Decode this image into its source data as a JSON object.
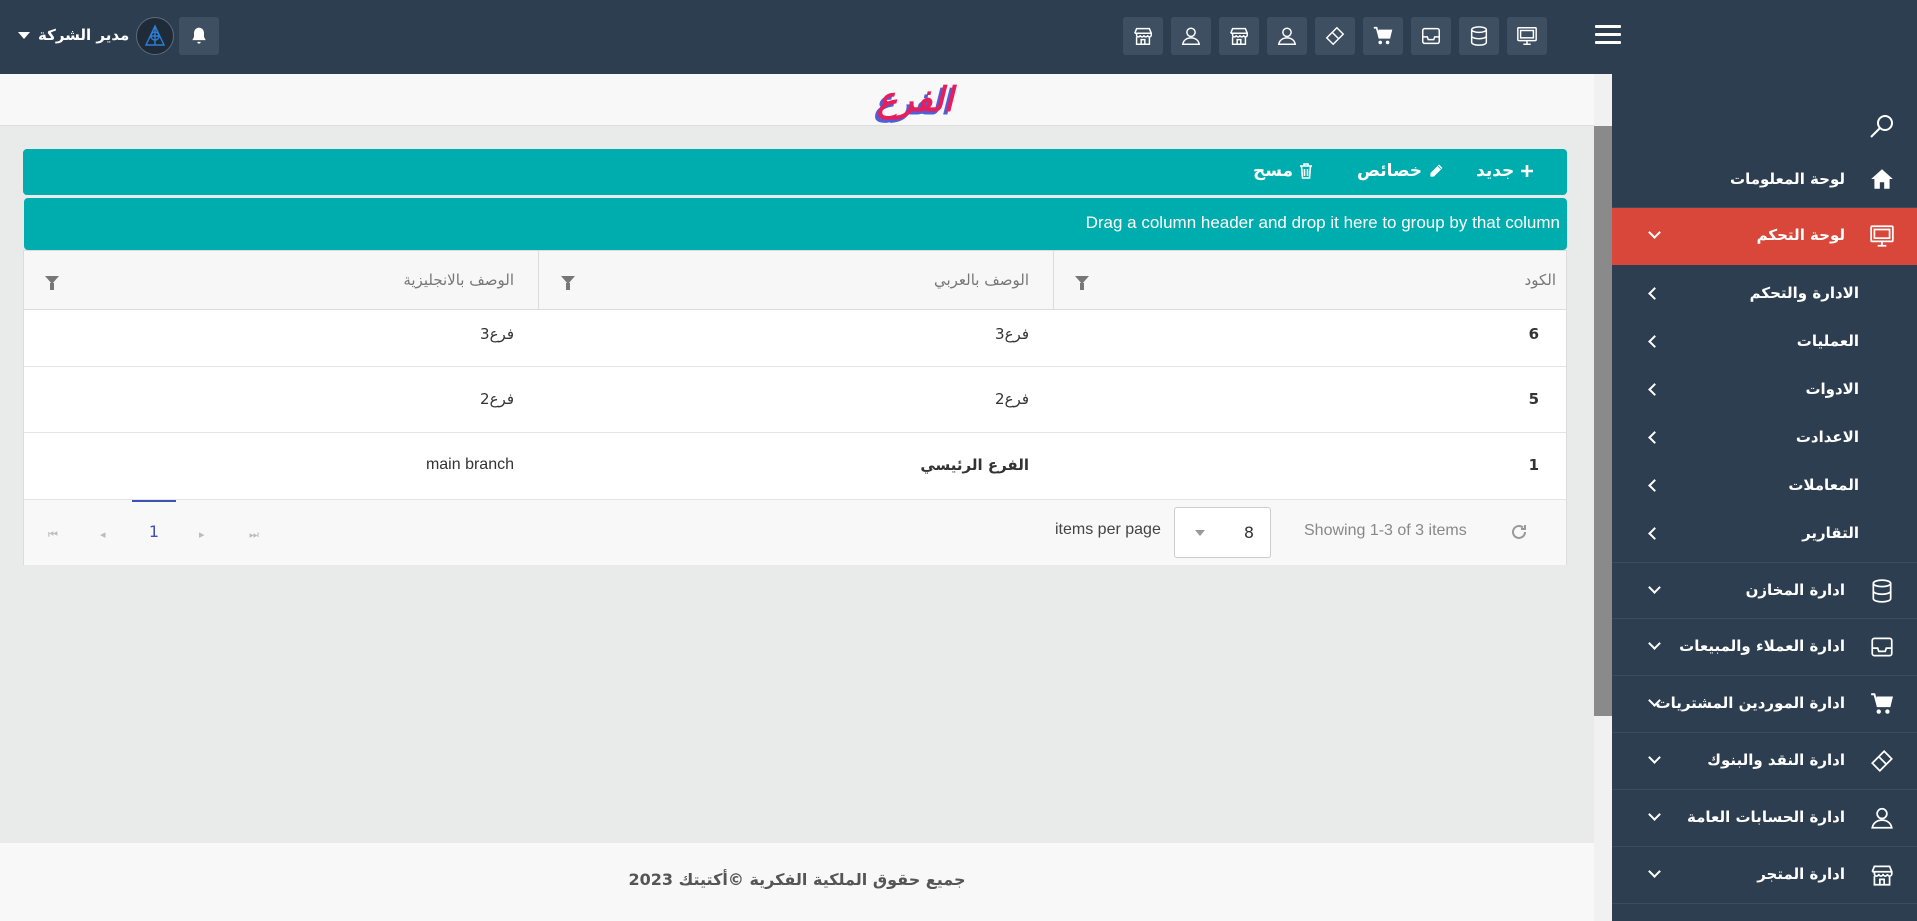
{
  "header": {
    "user_name": "مدير الشركة",
    "toolbar_icons": [
      "monitor-icon",
      "database-icon",
      "inbox-icon",
      "cart-icon",
      "ticket-icon",
      "user-icon",
      "store-icon",
      "user-icon",
      "store-icon"
    ]
  },
  "page": {
    "title": "الفرع"
  },
  "toolbar": {
    "new_label": "جديد",
    "properties_label": "خصائص",
    "delete_label": "مسح"
  },
  "grid": {
    "group_hint": "Drag a column header and drop it here to group by that column",
    "columns": [
      "الكود",
      "الوصف بالعربي",
      "الوصف بالانجليزية"
    ],
    "rows": [
      {
        "code": "6",
        "arabic": "فرع3",
        "english": "فرع3"
      },
      {
        "code": "5",
        "arabic": "فرع2",
        "english": "فرع2"
      },
      {
        "code": "1",
        "arabic": "الفرع الرئيسي",
        "english": "main branch"
      }
    ],
    "pager": {
      "current_page": "1",
      "items_per_page_label": "items per page",
      "items_per_page": "8",
      "showing": "Showing 1-3 of 3 items"
    }
  },
  "footer": {
    "copyright": "جميع حقوق الملكية الفكرية ©أكتيتك 2023"
  },
  "sidebar": {
    "items": [
      {
        "label": "لوحة المعلومات",
        "icon": "home-icon"
      },
      {
        "label": "لوحة التحكم",
        "icon": "monitor-icon",
        "active": true
      },
      {
        "label": "ادارة المخازن",
        "icon": "database-icon"
      },
      {
        "label": "ادارة العملاء والمبيعات",
        "icon": "inbox-icon"
      },
      {
        "label": "ادارة الموردين المشتريات",
        "icon": "cart-icon"
      },
      {
        "label": "ادارة النقد والبنوك",
        "icon": "ticket-icon"
      },
      {
        "label": "ادارة الحسابات العامة",
        "icon": "user-icon"
      },
      {
        "label": "ادارة المتجر",
        "icon": "store-icon"
      }
    ],
    "subitems": [
      "الادارة والتحكم",
      "العمليات",
      "الادوات",
      "الاعدادت",
      "المعاملات",
      "التقارير"
    ]
  },
  "colors": {
    "topbar": "#2c3e50",
    "accent_teal": "#00adae",
    "active_red": "#d9473a",
    "title_pink": "#e61e5c",
    "title_shadow": "#4f5fd6",
    "pager_blue": "#3f51b5"
  }
}
